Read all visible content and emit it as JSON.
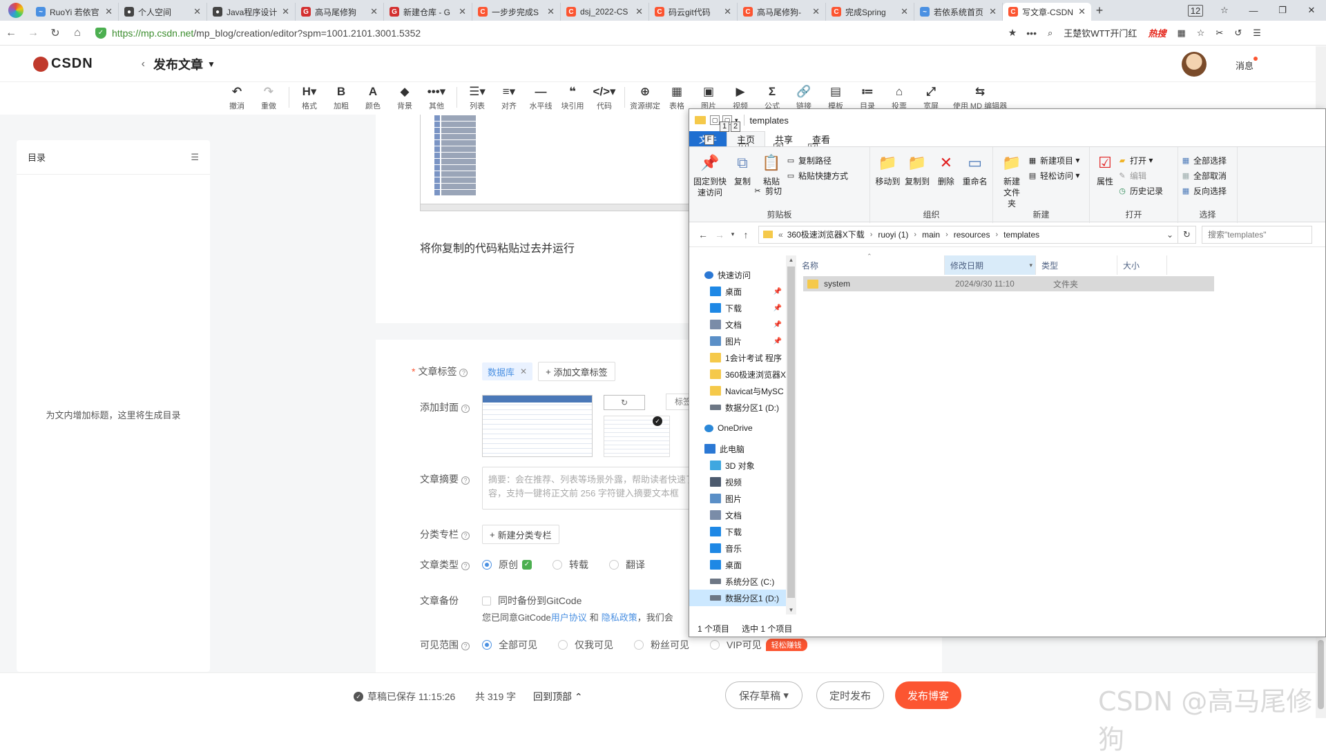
{
  "browser": {
    "tabs": [
      {
        "label": "RuoYi 若依官",
        "color": "#4a90e2",
        "glyph": "~"
      },
      {
        "label": "个人空间",
        "color": "#444444",
        "glyph": "●"
      },
      {
        "label": "Java程序设计",
        "color": "#444444",
        "glyph": "●"
      },
      {
        "label": "高马尾修狗",
        "color": "#d32f2f",
        "glyph": "G"
      },
      {
        "label": "新建仓库 - G",
        "color": "#d32f2f",
        "glyph": "G"
      },
      {
        "label": "一步步完成S",
        "color": "#fc5531",
        "glyph": "C"
      },
      {
        "label": "dsj_2022-CS",
        "color": "#fc5531",
        "glyph": "C"
      },
      {
        "label": "码云git代码",
        "color": "#fc5531",
        "glyph": "C"
      },
      {
        "label": "高马尾修狗-",
        "color": "#fc5531",
        "glyph": "C"
      },
      {
        "label": "完成Spring",
        "color": "#fc5531",
        "glyph": "C"
      },
      {
        "label": "若依系统首页",
        "color": "#4a90e2",
        "glyph": "~"
      },
      {
        "label": "写文章-CSDN",
        "color": "#fc5531",
        "glyph": "C"
      }
    ],
    "active_tab": 11,
    "tab_count": "12",
    "url_host": "https://mp.csdn.net",
    "url_path": "/mp_blog/creation/editor?spm=1001.2101.3001.5352",
    "search_hint": "王楚钦WTT开门红",
    "hot_label": "热搜"
  },
  "header": {
    "logo": "CSDN",
    "title": "发布文章",
    "messages": "消息"
  },
  "toolbar": [
    {
      "icon": "↶",
      "label": "撤消"
    },
    {
      "icon": "↷",
      "label": "重做",
      "disabled": true
    },
    {
      "icon": "H▾",
      "label": "格式"
    },
    {
      "icon": "B",
      "label": "加粗"
    },
    {
      "icon": "A",
      "label": "颜色"
    },
    {
      "icon": "◆",
      "label": "背景"
    },
    {
      "icon": "•••▾",
      "label": "其他"
    },
    {
      "icon": "☰▾",
      "label": "列表"
    },
    {
      "icon": "≡▾",
      "label": "对齐"
    },
    {
      "icon": "―",
      "label": "水平线"
    },
    {
      "icon": "❝",
      "label": "块引用"
    },
    {
      "icon": "</>▾",
      "label": "代码"
    },
    {
      "icon": "⊕",
      "label": "资源绑定"
    },
    {
      "icon": "▦",
      "label": "表格"
    },
    {
      "icon": "▣",
      "label": "图片"
    },
    {
      "icon": "▶",
      "label": "视频"
    },
    {
      "icon": "Σ",
      "label": "公式"
    },
    {
      "icon": "🔗",
      "label": "链接"
    },
    {
      "icon": "▤",
      "label": "模板"
    },
    {
      "icon": "≔",
      "label": "目录"
    },
    {
      "icon": "⌂",
      "label": "投票"
    },
    {
      "icon": "⤢",
      "label": "宽屏"
    },
    {
      "icon": "⇆",
      "label": "使用 MD 编辑器"
    }
  ],
  "toc": {
    "title": "目录",
    "empty_text": "为文内增加标题，这里将生成目录"
  },
  "editor": {
    "paragraph": "将你复制的代码粘贴过去并运行"
  },
  "settings": {
    "tags_label": "文章标签",
    "tag_chip": "数据库",
    "add_tag": "添加文章标签",
    "cover_label": "添加封面",
    "cover_tab": "标签",
    "summary_label": "文章摘要",
    "summary_placeholder": "摘要：会在推荐、列表等场景外露，帮助读者快速了解内容，支持一键将正文前 256 字符键入摘要文本框",
    "column_label": "分类专栏",
    "new_column": "新建分类专栏",
    "type_label": "文章类型",
    "types": [
      "原创",
      "转载",
      "翻译"
    ],
    "backup_label": "文章备份",
    "backup_option": "同时备份到GitCode",
    "agree_prefix": "您已同意GitCode",
    "agree_link1": "用户协议",
    "agree_and": "和",
    "agree_link2": "隐私政策",
    "agree_suffix": "，我们会",
    "visibility_label": "可见范围",
    "visibility": [
      "全部可见",
      "仅我可见",
      "粉丝可见",
      "VIP可见"
    ],
    "vip_badge": "轻松赚钱"
  },
  "bottom": {
    "saved": "草稿已保存 11:15:26",
    "count": "共 319 字",
    "back_top": "回到顶部",
    "save_draft": "保存草稿",
    "schedule": "定时发布",
    "publish": "发布博客",
    "watermark": "CSDN @高马尾修狗"
  },
  "explorer": {
    "title": "templates",
    "tabs": [
      "文件",
      "主页",
      "共享",
      "查看"
    ],
    "keytips": [
      "1",
      "2",
      "F",
      "H",
      "S",
      "V"
    ],
    "ribbon": {
      "clipboard": {
        "name": "剪贴板",
        "pin": "固定到快速访问",
        "copy": "复制",
        "paste": "粘贴",
        "copy_path": "复制路径",
        "paste_shortcut": "粘贴快捷方式",
        "cut": "剪切"
      },
      "organize": {
        "name": "组织",
        "move_to": "移动到",
        "copy_to": "复制到",
        "delete": "删除",
        "rename": "重命名"
      },
      "new": {
        "name": "新建",
        "new_folder": "新建文件夹",
        "new_item": "新建项目",
        "easy_access": "轻松访问"
      },
      "open": {
        "name": "打开",
        "properties": "属性",
        "open": "打开",
        "edit": "编辑",
        "history": "历史记录"
      },
      "select": {
        "name": "选择",
        "select_all": "全部选择",
        "select_none": "全部取消",
        "invert": "反向选择"
      }
    },
    "breadcrumb": [
      "360极速浏览器X下载",
      "ruoyi (1)",
      "main",
      "resources",
      "templates"
    ],
    "search_placeholder": "搜索\"templates\"",
    "nav": [
      {
        "label": "快速访问",
        "level": 1,
        "icon": "star",
        "color": "#2b78d4"
      },
      {
        "label": "桌面",
        "level": 2,
        "icon": "desk",
        "color": "#1e88e5",
        "pin": true
      },
      {
        "label": "下载",
        "level": 2,
        "icon": "down",
        "color": "#1e88e5",
        "pin": true
      },
      {
        "label": "文档",
        "level": 2,
        "icon": "doc",
        "color": "#7a8ca8",
        "pin": true
      },
      {
        "label": "图片",
        "level": 2,
        "icon": "pic",
        "color": "#5a8fc7",
        "pin": true
      },
      {
        "label": "1会计考试 程序",
        "level": 2,
        "icon": "folder",
        "color": "#f5c94a"
      },
      {
        "label": "360极速浏览器X",
        "level": 2,
        "icon": "folder",
        "color": "#f5c94a"
      },
      {
        "label": "Navicat与MySC",
        "level": 2,
        "icon": "folder",
        "color": "#f5c94a"
      },
      {
        "label": "数据分区1 (D:)",
        "level": 2,
        "icon": "drive",
        "color": "#6d7785"
      },
      {
        "label": "OneDrive",
        "level": 1,
        "icon": "cloud",
        "color": "#2b88d8",
        "gap": true
      },
      {
        "label": "此电脑",
        "level": 1,
        "icon": "pc",
        "color": "#2b78d4",
        "gap": true
      },
      {
        "label": "3D 对象",
        "level": 2,
        "icon": "3d",
        "color": "#3fa7e0"
      },
      {
        "label": "视频",
        "level": 2,
        "icon": "video",
        "color": "#4c5a6e"
      },
      {
        "label": "图片",
        "level": 2,
        "icon": "pic",
        "color": "#5a8fc7"
      },
      {
        "label": "文档",
        "level": 2,
        "icon": "doc",
        "color": "#7a8ca8"
      },
      {
        "label": "下载",
        "level": 2,
        "icon": "down",
        "color": "#1e88e5"
      },
      {
        "label": "音乐",
        "level": 2,
        "icon": "music",
        "color": "#1e88e5"
      },
      {
        "label": "桌面",
        "level": 2,
        "icon": "desk",
        "color": "#1e88e5"
      },
      {
        "label": "系统分区 (C:)",
        "level": 2,
        "icon": "drive",
        "color": "#6d7785"
      },
      {
        "label": "数据分区1 (D:)",
        "level": 2,
        "icon": "drive",
        "color": "#6d7785",
        "selected": true
      }
    ],
    "columns": [
      "名称",
      "修改日期",
      "类型",
      "大小"
    ],
    "files": [
      {
        "name": "system",
        "modified": "2024/9/30 11:10",
        "type": "文件夹",
        "size": ""
      }
    ],
    "status": {
      "items": "1 个项目",
      "selected": "选中 1 个项目"
    }
  }
}
